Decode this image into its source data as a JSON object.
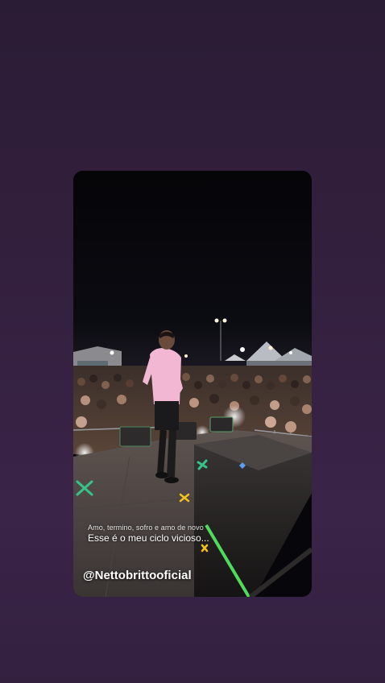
{
  "story": {
    "lyrics": {
      "line_1": "Amo, termino, sofro e amo de novo",
      "line_2": "Esse é o meu ciclo vicioso..."
    },
    "handle": "@Nettobrittooficial"
  },
  "colors": {
    "background": "#34203f",
    "night_sky": "#07070b",
    "shirt": "#f2b8d3",
    "stage_stripe": "#4fdc5a",
    "sparkle": "#36c38a"
  }
}
